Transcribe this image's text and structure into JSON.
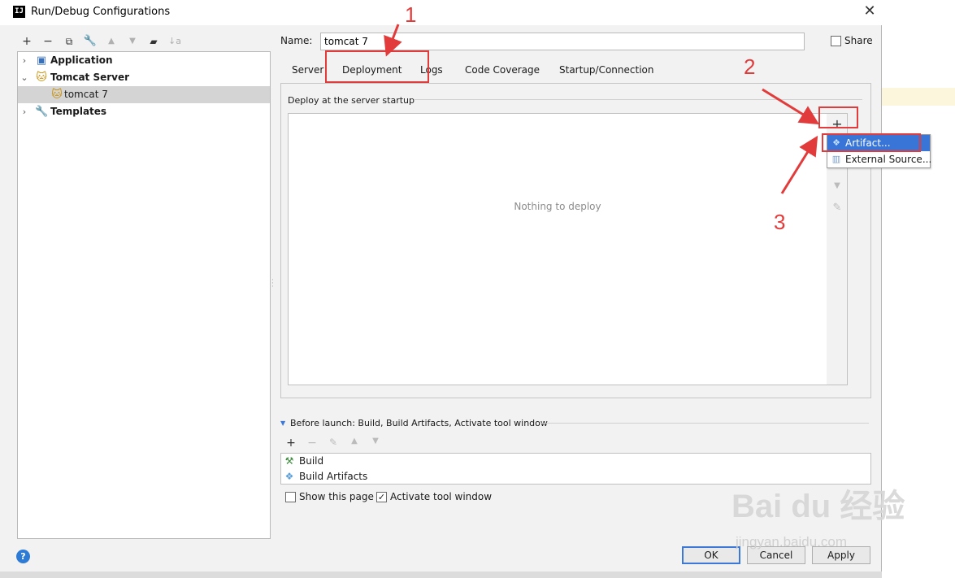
{
  "window": {
    "title": "Run/Debug Configurations",
    "close_glyph": "✕",
    "app_icon_text": "IJ"
  },
  "left_toolbar": [
    "add-icon",
    "remove-icon",
    "copy-icon",
    "wrench-icon",
    "move-up-icon",
    "move-down-icon",
    "folder-icon",
    "sort-icon"
  ],
  "tree": {
    "items": [
      {
        "label": "Application",
        "icon": "application-icon",
        "bold": true,
        "chevron": "›"
      },
      {
        "label": "Tomcat Server",
        "icon": "tomcat-icon",
        "bold": true,
        "chevron": "⌄"
      },
      {
        "label": "tomcat 7",
        "icon": "tomcat-icon",
        "selected": true
      },
      {
        "label": "Templates",
        "icon": "wrench-icon",
        "bold": true,
        "chevron": "›"
      }
    ]
  },
  "name": {
    "label": "Name:",
    "value": "tomcat 7"
  },
  "share": {
    "label": "Share",
    "checked": false
  },
  "tabs": [
    "Server",
    "Deployment",
    "Logs",
    "Code Coverage",
    "Startup/Connection"
  ],
  "active_tab": "Deployment",
  "deployment": {
    "section_title": "Deploy at the server startup",
    "empty_text": "Nothing to deploy",
    "side_toolbar": [
      "add-icon",
      "remove-icon",
      "move-up-icon",
      "move-down-icon",
      "edit-icon"
    ]
  },
  "add_popup": {
    "items": [
      {
        "label": "Artifact...",
        "icon": "artifact-icon",
        "highlighted": true
      },
      {
        "label": "External Source...",
        "icon": "external-source-icon"
      }
    ]
  },
  "before_launch": {
    "title": "Before launch: Build, Build Artifacts, Activate tool window",
    "toolbar": [
      "add-icon",
      "remove-icon",
      "edit-icon",
      "move-up-icon",
      "move-down-icon"
    ],
    "items": [
      {
        "label": "Build",
        "icon": "hammer-icon"
      },
      {
        "label": "Build Artifacts",
        "icon": "artifact-icon"
      }
    ]
  },
  "options": {
    "show_this_page": {
      "label": "Show this page",
      "checked": false
    },
    "activate_tool_window": {
      "label": "Activate tool window",
      "checked": true
    }
  },
  "buttons": {
    "ok": "OK",
    "cancel": "Cancel",
    "apply": "Apply",
    "help": "?"
  },
  "annotations": {
    "n1": "1",
    "n2": "2",
    "n3": "3",
    "color": "#e23b3b"
  },
  "watermark": {
    "main": "Bai du 经验",
    "sub": "jingyan.baidu.com"
  }
}
